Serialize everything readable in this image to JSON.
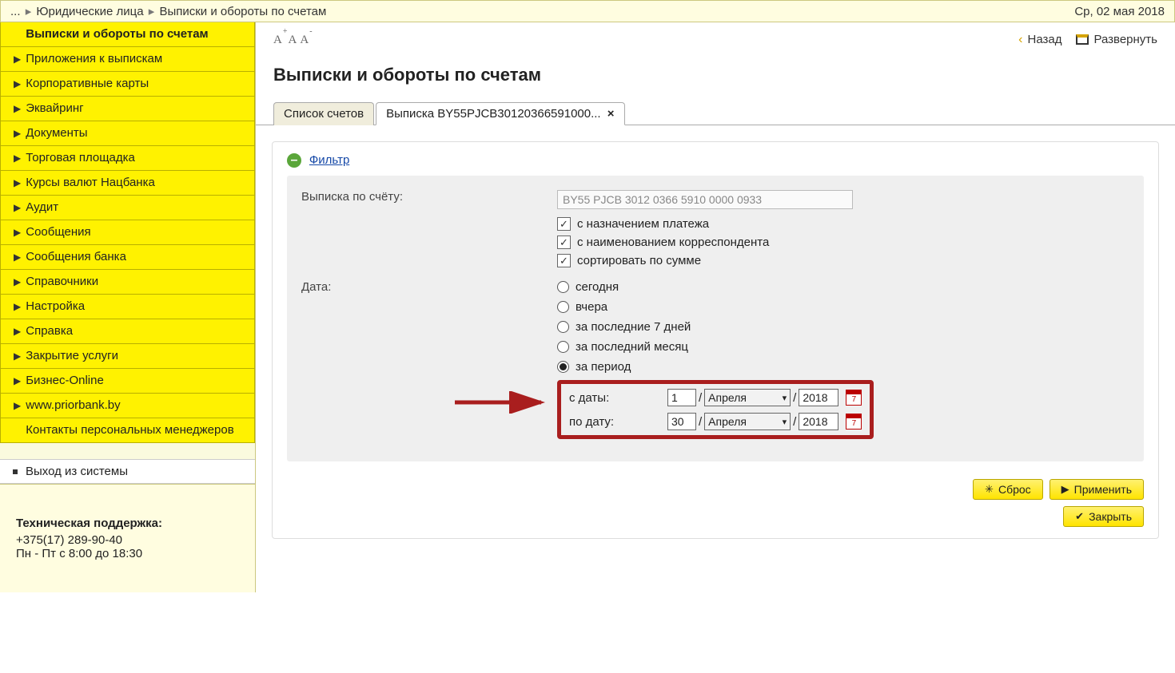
{
  "breadcrumb": {
    "prefix": "...",
    "items": [
      "Юридические лица",
      "Выписки и обороты по счетам"
    ],
    "date": "Ср, 02 мая 2018"
  },
  "sidebar": {
    "items": [
      {
        "label": "Выписки и обороты по счетам",
        "active": true,
        "expandable": false
      },
      {
        "label": "Приложения к выпискам",
        "expandable": true
      },
      {
        "label": "Корпоративные карты",
        "expandable": true
      },
      {
        "label": "Эквайринг",
        "expandable": true
      },
      {
        "label": "Документы",
        "expandable": true
      },
      {
        "label": "Торговая площадка",
        "expandable": true
      },
      {
        "label": "Курсы валют Нацбанка",
        "expandable": true
      },
      {
        "label": "Аудит",
        "expandable": true
      },
      {
        "label": "Сообщения",
        "expandable": true
      },
      {
        "label": "Сообщения банка",
        "expandable": true
      },
      {
        "label": "Справочники",
        "expandable": true
      },
      {
        "label": "Настройка",
        "expandable": true
      },
      {
        "label": "Справка",
        "expandable": true
      },
      {
        "label": "Закрытие услуги",
        "expandable": true
      },
      {
        "label": "Бизнес-Online",
        "expandable": true
      },
      {
        "label": "www.priorbank.by",
        "expandable": true
      },
      {
        "label": "Контакты персональных менеджеров",
        "expandable": false
      }
    ],
    "logout": "Выход из системы",
    "support": {
      "title": "Техническая поддержка:",
      "phone": "+375(17) 289-90-40",
      "hours": "Пн - Пт с 8:00 до 18:30"
    }
  },
  "topbar": {
    "back": "Назад",
    "expand": "Развернуть"
  },
  "page": {
    "title": "Выписки и обороты по счетам"
  },
  "tabs": {
    "list": "Список счетов",
    "detail": "Выписка BY55PJCB30120366591000..."
  },
  "filter": {
    "toggle": "Фильтр",
    "account_label": "Выписка по счёту:",
    "account_value": "BY55 PJCB 3012 0366 5910 0000 0933",
    "checks": {
      "purpose": "с назначением платежа",
      "counterparty": "с наименованием корреспондента",
      "sort_amount": "сортировать по сумме"
    },
    "date_label": "Дата:",
    "radios": {
      "today": "сегодня",
      "yesterday": "вчера",
      "last7": "за последние 7 дней",
      "lastmonth": "за последний месяц",
      "period": "за период"
    },
    "period": {
      "from_label": "с даты:",
      "to_label": "по дату:",
      "from": {
        "day": "1",
        "month": "Апреля",
        "year": "2018"
      },
      "to": {
        "day": "30",
        "month": "Апреля",
        "year": "2018"
      },
      "cal_day": "7"
    }
  },
  "buttons": {
    "reset": "Сброс",
    "apply": "Применить",
    "close": "Закрыть"
  }
}
